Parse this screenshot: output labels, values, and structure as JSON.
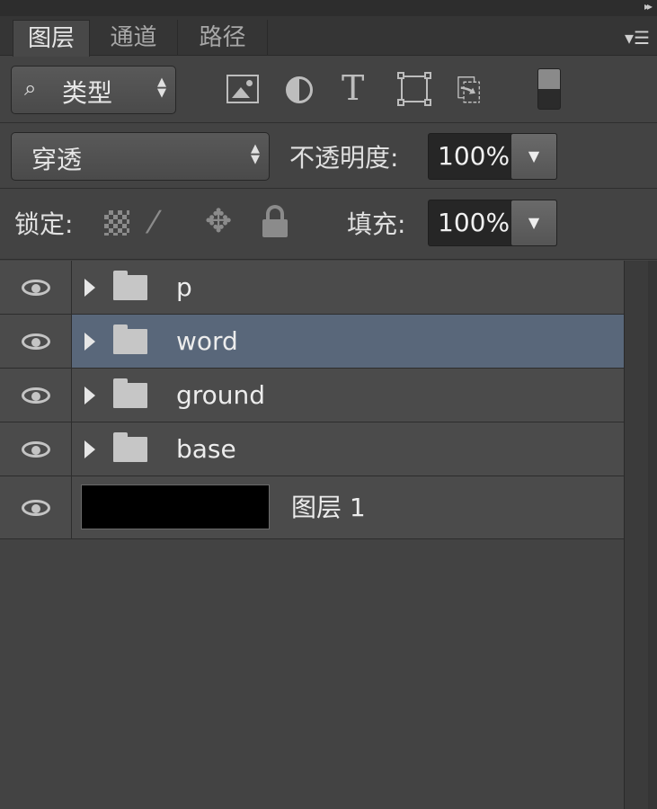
{
  "panel": {
    "collapse_glyph": "▸▸",
    "menu_glyph": "▾☰"
  },
  "tabs": [
    {
      "label": "图层",
      "active": true
    },
    {
      "label": "通道",
      "active": false
    },
    {
      "label": "路径",
      "active": false
    }
  ],
  "filter": {
    "kind_label": "类型",
    "icons": [
      "image-filter-icon",
      "adjustment-filter-icon",
      "type-filter-icon",
      "shape-filter-icon",
      "smart-object-filter-icon",
      "filter-toggle-switch"
    ]
  },
  "blend": {
    "mode": "穿透",
    "opacity_label": "不透明度:",
    "opacity_value": "100%"
  },
  "lock": {
    "label": "锁定:",
    "fill_label": "填充:",
    "fill_value": "100%"
  },
  "layers": [
    {
      "name": "p",
      "type": "group",
      "visible": true,
      "selected": false
    },
    {
      "name": "word",
      "type": "group",
      "visible": true,
      "selected": true
    },
    {
      "name": "ground",
      "type": "group",
      "visible": true,
      "selected": false
    },
    {
      "name": "base",
      "type": "group",
      "visible": true,
      "selected": false
    },
    {
      "name": "图层 1",
      "type": "pixel",
      "visible": true,
      "selected": false,
      "thumbnail_color": "#000000"
    }
  ],
  "colors": {
    "panel_bg": "#434343",
    "selected_row": "#59677a",
    "row_bg": "#4b4b4b"
  }
}
